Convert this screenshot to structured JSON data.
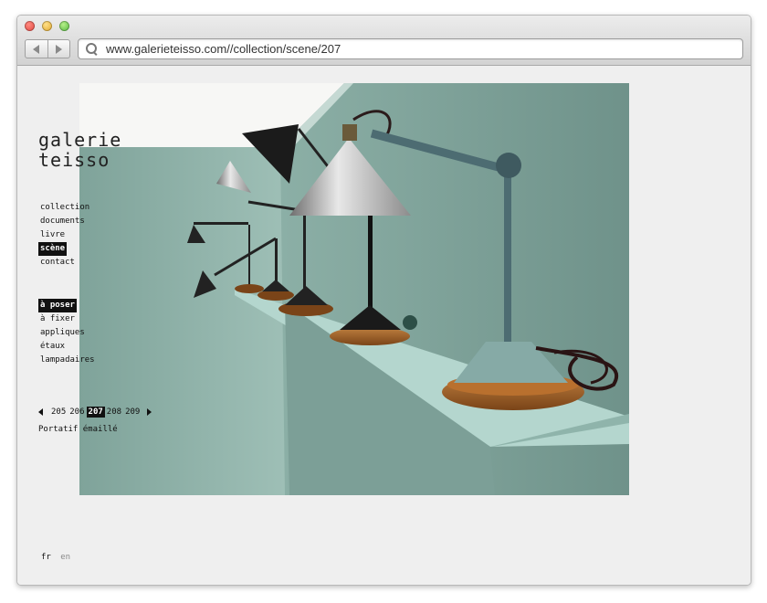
{
  "browser": {
    "url": "www.galerieteisso.com//collection/scene/207"
  },
  "site": {
    "logo_line1": "galerie",
    "logo_line2": "teisso"
  },
  "menu_main": [
    "collection",
    "documents",
    "livre",
    "scène",
    "contact"
  ],
  "menu_main_active": "scène",
  "menu_categories": [
    "à poser",
    "à fixer",
    "appliques",
    "étaux",
    "lampadaires"
  ],
  "menu_categories_active": "à poser",
  "pager": {
    "pages": [
      "205",
      "206",
      "207",
      "208",
      "209"
    ],
    "current": "207"
  },
  "caption": "Portatif émaillé",
  "lang": {
    "fr": "fr",
    "en": "en"
  },
  "colors": {
    "wall": "#8fb0a6",
    "shelf": "#a9cfc7",
    "active_bg": "#111111"
  }
}
